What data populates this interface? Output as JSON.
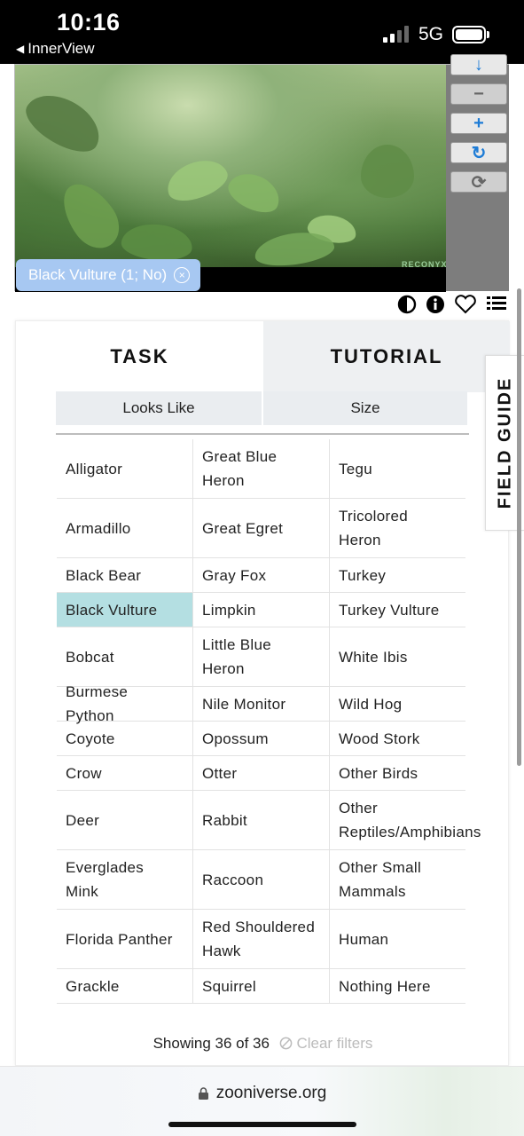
{
  "status_bar": {
    "time": "10:16",
    "back_app": "InnerView",
    "network": "5G"
  },
  "viewer": {
    "tag_label": "Black Vulture (1; No)",
    "tag_close": "×",
    "camera_brand": "RECONYX",
    "tools": [
      {
        "name": "zoom-out",
        "glyph": "−"
      },
      {
        "name": "zoom-in",
        "glyph": "+"
      },
      {
        "name": "rotate",
        "glyph": "↻"
      },
      {
        "name": "reset",
        "glyph": "⟳"
      }
    ]
  },
  "icons": [
    "contrast-icon",
    "info-icon",
    "heart-icon",
    "list-icon"
  ],
  "tabs": {
    "task": "TASK",
    "tutorial": "TUTORIAL"
  },
  "filters": {
    "looks_like": "Looks Like",
    "size": "Size"
  },
  "choices": [
    [
      "Alligator",
      "Great Blue Heron",
      "Tegu"
    ],
    [
      "Armadillo",
      "Great Egret",
      "Tricolored Heron"
    ],
    [
      "Black Bear",
      "Gray Fox",
      "Turkey"
    ],
    [
      "Black Vulture",
      "Limpkin",
      "Turkey Vulture"
    ],
    [
      "Bobcat",
      "Little Blue Heron",
      "White Ibis"
    ],
    [
      "Burmese Python",
      "Nile Monitor",
      "Wild Hog"
    ],
    [
      "Coyote",
      "Opossum",
      "Wood Stork"
    ],
    [
      "Crow",
      "Otter",
      "Other Birds"
    ],
    [
      "Deer",
      "Rabbit",
      "Other Reptiles/Amphibians"
    ],
    [
      "Everglades Mink",
      "Raccoon",
      "Other Small Mammals"
    ],
    [
      "Florida Panther",
      "Red Shouldered Hawk",
      "Human"
    ],
    [
      "Grackle",
      "Squirrel",
      "Nothing Here"
    ]
  ],
  "selected_choice": "Black Vulture",
  "footer": {
    "showing": "Showing 36 of 36",
    "clear": "Clear filters"
  },
  "field_guide": "FIELD GUIDE",
  "browser": {
    "url": "zooniverse.org"
  }
}
